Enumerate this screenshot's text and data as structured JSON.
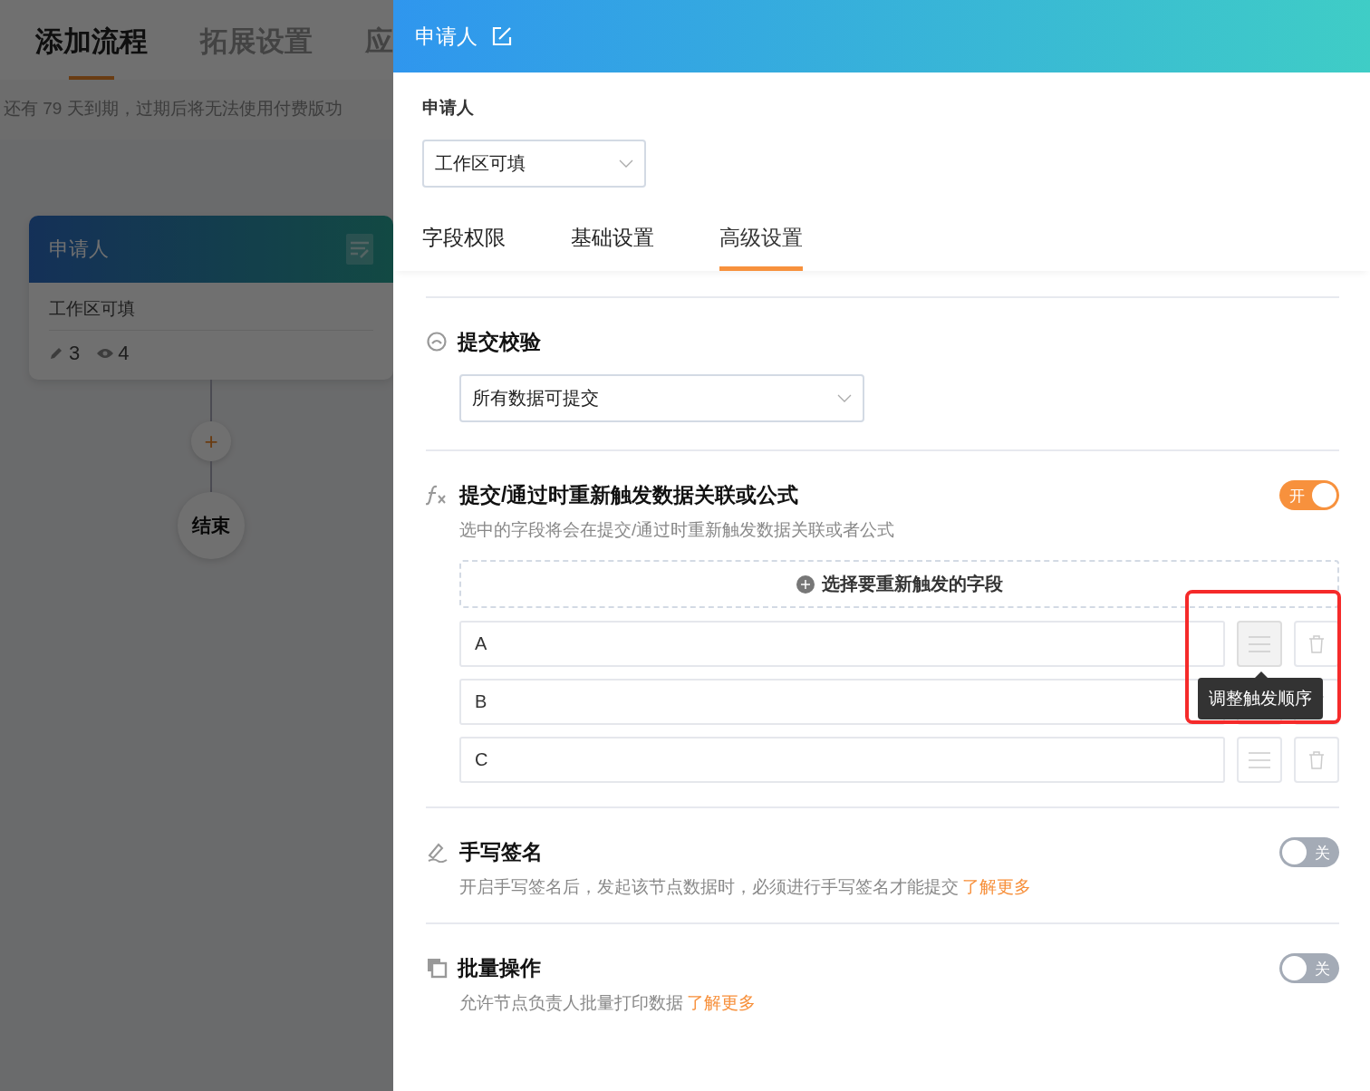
{
  "background_page": {
    "tabs": [
      {
        "label": "添加流程",
        "selected": true
      },
      {
        "label": "拓展设置",
        "selected": false
      },
      {
        "label": "应",
        "selected": false
      }
    ],
    "notice": "还有 79 天到期，过期后将无法使用付费版功",
    "flow": {
      "node": {
        "title": "申请人",
        "subtitle": "工作区可填",
        "edit_count": "3",
        "view_count": "4"
      },
      "add_button": "+",
      "end_node": "结束"
    }
  },
  "panel": {
    "title": "申请人",
    "applicant_label": "申请人",
    "applicant_select": "工作区可填",
    "tabs": [
      {
        "label": "字段权限",
        "selected": false
      },
      {
        "label": "基础设置",
        "selected": false
      },
      {
        "label": "高级设置",
        "selected": true
      }
    ],
    "sections": [
      {
        "kind": "select",
        "title": "提交校验",
        "value": "所有数据可提交"
      },
      {
        "kind": "fields",
        "title": "提交/通过时重新触发数据关联或公式",
        "on": true,
        "toggle_label": "开",
        "description": "选中的字段将会在提交/通过时重新触发数据关联或者公式",
        "add_button": "选择要重新触发的字段",
        "fields": [
          "A",
          "B",
          "C"
        ],
        "tooltip": "调整触发顺序"
      },
      {
        "kind": "toggle",
        "title": "手写签名",
        "on": false,
        "toggle_label": "关",
        "description": "开启手写签名后，发起该节点数据时，必须进行手写签名才能提交",
        "link": "了解更多"
      },
      {
        "kind": "toggle",
        "title": "批量操作",
        "on": false,
        "toggle_label": "关",
        "description": "允许节点负责人批量打印数据",
        "link": "了解更多"
      }
    ]
  }
}
